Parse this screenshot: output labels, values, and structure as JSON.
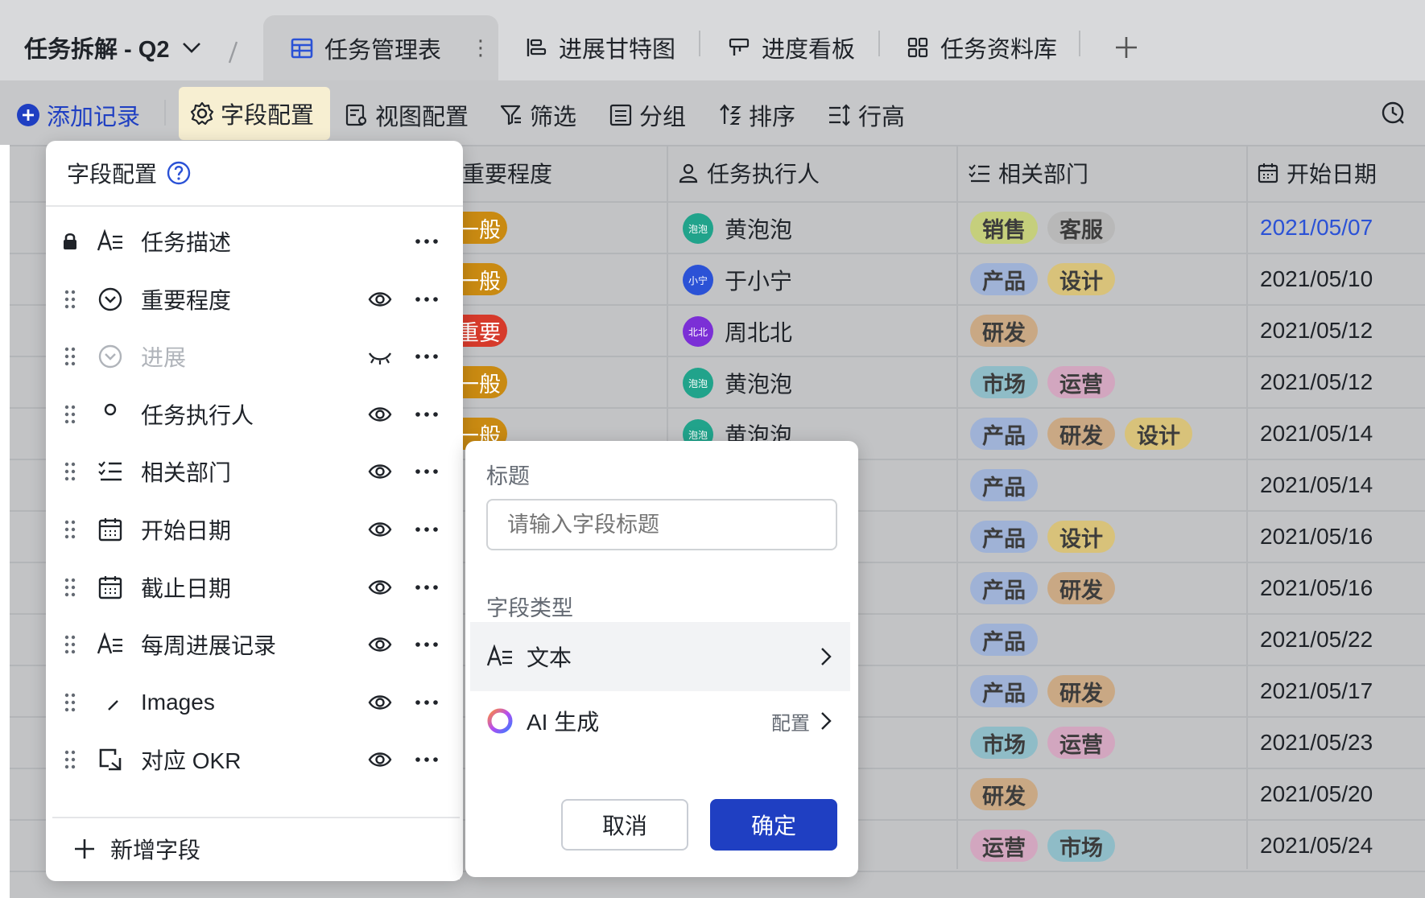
{
  "workspace": {
    "title": "任务拆解 - Q2"
  },
  "tabs": [
    {
      "label": "任务管理表",
      "active": true,
      "icon": "table-icon"
    },
    {
      "label": "进展甘特图",
      "icon": "gantt-icon"
    },
    {
      "label": "进度看板",
      "icon": "kanban-icon"
    },
    {
      "label": "任务资料库",
      "icon": "gallery-icon"
    }
  ],
  "toolbar": {
    "add_record": "添加记录",
    "field_config": "字段配置",
    "view_config": "视图配置",
    "filter": "筛选",
    "group": "分组",
    "sort": "排序",
    "row_height": "行高"
  },
  "grid": {
    "columns": [
      "重要程度",
      "任务执行人",
      "相关部门",
      "开始日期"
    ],
    "rows": [
      {
        "importance": "一般",
        "imp_color": "#c98a12",
        "person": "黄泡泡",
        "avatar": "泡泡",
        "avatar_color": "#21a38b",
        "depts": [
          "销售",
          "客服"
        ],
        "date": "2021/05/07",
        "date_link": true
      },
      {
        "importance": "一般",
        "imp_color": "#c98a12",
        "person": "于小宁",
        "avatar": "小宁",
        "avatar_color": "#2b52d6",
        "depts": [
          "产品",
          "设计"
        ],
        "date": "2021/05/10"
      },
      {
        "importance": "重要",
        "imp_color": "#d63a2b",
        "person": "周北北",
        "avatar": "北北",
        "avatar_color": "#7b2fd6",
        "depts": [
          "研发"
        ],
        "date": "2021/05/12"
      },
      {
        "importance": "一般",
        "imp_color": "#c98a12",
        "person": "黄泡泡",
        "avatar": "泡泡",
        "avatar_color": "#21a38b",
        "depts": [
          "市场",
          "运营"
        ],
        "date": "2021/05/12"
      },
      {
        "importance": "一般",
        "imp_color": "#c98a12",
        "person": "黄泡泡",
        "avatar": "泡泡",
        "avatar_color": "#21a38b",
        "depts": [
          "产品",
          "研发",
          "设计"
        ],
        "date": "2021/05/14"
      },
      {
        "depts": [
          "产品"
        ],
        "date": "2021/05/14"
      },
      {
        "depts": [
          "产品",
          "设计"
        ],
        "date": "2021/05/16"
      },
      {
        "depts": [
          "产品",
          "研发"
        ],
        "date": "2021/05/16"
      },
      {
        "depts": [
          "产品"
        ],
        "date": "2021/05/22"
      },
      {
        "depts": [
          "产品",
          "研发"
        ],
        "date": "2021/05/17"
      },
      {
        "depts": [
          "市场",
          "运营"
        ],
        "date": "2021/05/23"
      },
      {
        "depts": [
          "研发"
        ],
        "date": "2021/05/20"
      },
      {
        "depts": [
          "运营",
          "市场"
        ],
        "date": "2021/05/24"
      }
    ],
    "dept_colors": {
      "销售": "#c5cf7c",
      "客服": "#b8b8b8",
      "产品": "#9fb2d6",
      "设计": "#d8c27a",
      "研发": "#c9a884",
      "市场": "#8fbcc7",
      "运营": "#d2a6bf"
    }
  },
  "field_panel": {
    "title": "字段配置",
    "fields": [
      {
        "label": "任务描述",
        "icon": "text-icon",
        "locked": true
      },
      {
        "label": "重要程度",
        "icon": "single-select-icon"
      },
      {
        "label": "进展",
        "icon": "single-select-icon",
        "hidden": true
      },
      {
        "label": "任务执行人",
        "icon": "person-icon"
      },
      {
        "label": "相关部门",
        "icon": "multi-select-icon"
      },
      {
        "label": "开始日期",
        "icon": "calendar-icon"
      },
      {
        "label": "截止日期",
        "icon": "calendar-icon"
      },
      {
        "label": "每周进展记录",
        "icon": "text-icon"
      },
      {
        "label": "Images",
        "icon": "attachment-icon"
      },
      {
        "label": "对应 OKR",
        "icon": "link-icon"
      }
    ],
    "add_field": "新增字段"
  },
  "new_field_popup": {
    "title_label": "标题",
    "title_placeholder": "请输入字段标题",
    "type_label": "字段类型",
    "type_text": "文本",
    "type_ai": "AI 生成",
    "ai_config": "配置",
    "cancel": "取消",
    "confirm": "确定"
  },
  "colors": {
    "accent": "#1f3fc2",
    "link": "#2b52d6",
    "field_highlight": "#f7efd2"
  }
}
